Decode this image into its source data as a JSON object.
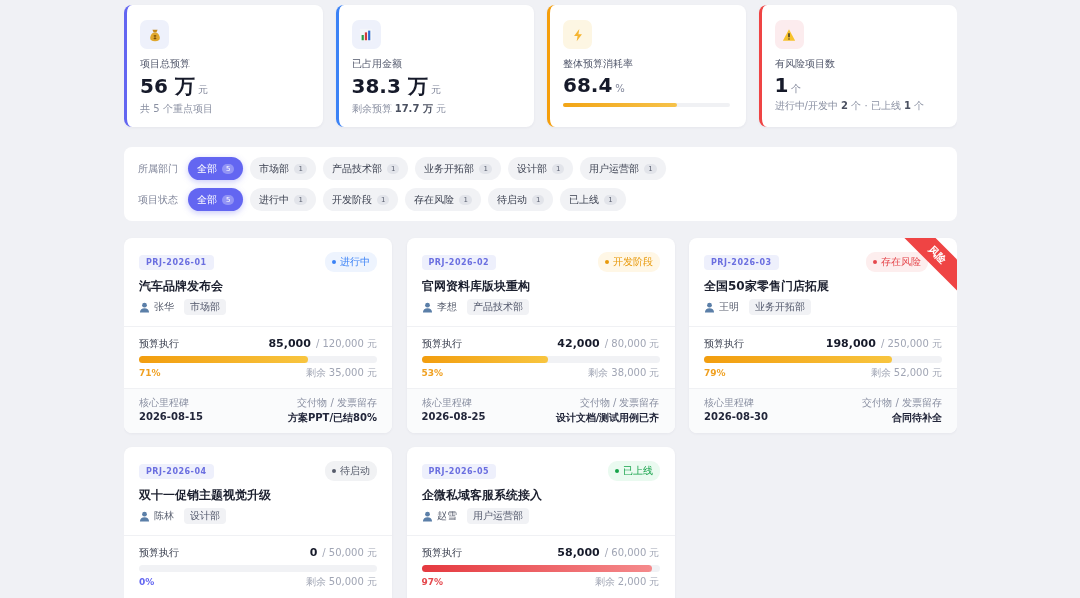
{
  "stats": [
    {
      "kind": "money",
      "color": "#6366f1",
      "label": "项目总预算",
      "value": "56 万",
      "unit": "元",
      "note": "共 5 个重点项目"
    },
    {
      "kind": "chart",
      "color": "#3b82f6",
      "label": "已占用金额",
      "value": "38.3 万",
      "unit": "元",
      "note": "剩余预算 **17.7 万** 元"
    },
    {
      "kind": "bolt",
      "color": "#f59e0b",
      "label": "整体预算消耗率",
      "value": "68.4",
      "unit": "%",
      "level": 0.684
    },
    {
      "kind": "warning",
      "color": "#ef4444",
      "label": "有风险项目数",
      "value": "1",
      "unit": "个",
      "note": "进行中/开发中 **2** 个 · 已上线 **1** 个"
    }
  ],
  "filters": [
    {
      "label": "所属部门",
      "chips": [
        {
          "label": "全部",
          "count": "5",
          "selected": true
        },
        {
          "label": "市场部",
          "count": "1",
          "selected": false
        },
        {
          "label": "产品技术部",
          "count": "1",
          "selected": false
        },
        {
          "label": "业务开拓部",
          "count": "1",
          "selected": false
        },
        {
          "label": "设计部",
          "count": "1",
          "selected": false
        },
        {
          "label": "用户运营部",
          "count": "1",
          "selected": false
        }
      ]
    },
    {
      "label": "项目状态",
      "chips": [
        {
          "label": "全部",
          "count": "5",
          "selected": true
        },
        {
          "label": "进行中",
          "count": "1",
          "selected": false
        },
        {
          "label": "开发阶段",
          "count": "1",
          "selected": false
        },
        {
          "label": "存在风险",
          "count": "1",
          "selected": false
        },
        {
          "label": "待启动",
          "count": "1",
          "selected": false
        },
        {
          "label": "已上线",
          "count": "1",
          "selected": false
        }
      ]
    }
  ],
  "projects": [
    {
      "code": "PRJ-2026-01",
      "status": {
        "label": "进行中",
        "kind": "active"
      },
      "title": "汽车品牌发布会",
      "owner": "张华",
      "dept": "市场部",
      "budget_label": "预算执行",
      "spent": "85,000",
      "total": "/ 120,000 元",
      "level": 0.71,
      "percent": "71%",
      "remaining": "剩余 35,000 元",
      "milestone_label": "核心里程碑",
      "milestone": "2026-08-15",
      "deliverable_label": "交付物 / 发票留存",
      "deliverable": "方案PPT/已结80%"
    },
    {
      "code": "PRJ-2026-02",
      "status": {
        "label": "开发阶段",
        "kind": "dev"
      },
      "title": "官网资料库版块重构",
      "owner": "李想",
      "dept": "产品技术部",
      "budget_label": "预算执行",
      "spent": "42,000",
      "total": "/ 80,000 元",
      "level": 0.53,
      "percent": "53%",
      "remaining": "剩余 38,000 元",
      "milestone_label": "核心里程碑",
      "milestone": "2026-08-25",
      "deliverable_label": "交付物 / 发票留存",
      "deliverable": "设计文档/测试用例已齐"
    },
    {
      "code": "PRJ-2026-03",
      "status": {
        "label": "存在风险",
        "kind": "risk"
      },
      "ribbon": "风险",
      "title": "全国50家零售门店拓展",
      "owner": "王明",
      "dept": "业务开拓部",
      "budget_label": "预算执行",
      "spent": "198,000",
      "total": "/ 250,000 元",
      "level": 0.79,
      "percent": "79%",
      "remaining": "剩余 52,000 元",
      "milestone_label": "核心里程碑",
      "milestone": "2026-08-30",
      "deliverable_label": "交付物 / 发票留存",
      "deliverable": "合同待补全"
    },
    {
      "code": "PRJ-2026-04",
      "status": {
        "label": "待启动",
        "kind": "pending"
      },
      "title": "双十一促销主题视觉升级",
      "owner": "陈林",
      "dept": "设计部",
      "budget_label": "预算执行",
      "spent": "0",
      "total": "/ 50,000 元",
      "level": 0,
      "percent": "0%",
      "remaining": "剩余 50,000 元"
    },
    {
      "code": "PRJ-2026-05",
      "status": {
        "label": "已上线",
        "kind": "live"
      },
      "title": "企微私域客服系统接入",
      "owner": "赵雪",
      "dept": "用户运营部",
      "budget_label": "预算执行",
      "spent": "58,000",
      "total": "/ 60,000 元",
      "level": 0.97,
      "percent": "97%",
      "remaining": "剩余 2,000 元"
    }
  ]
}
